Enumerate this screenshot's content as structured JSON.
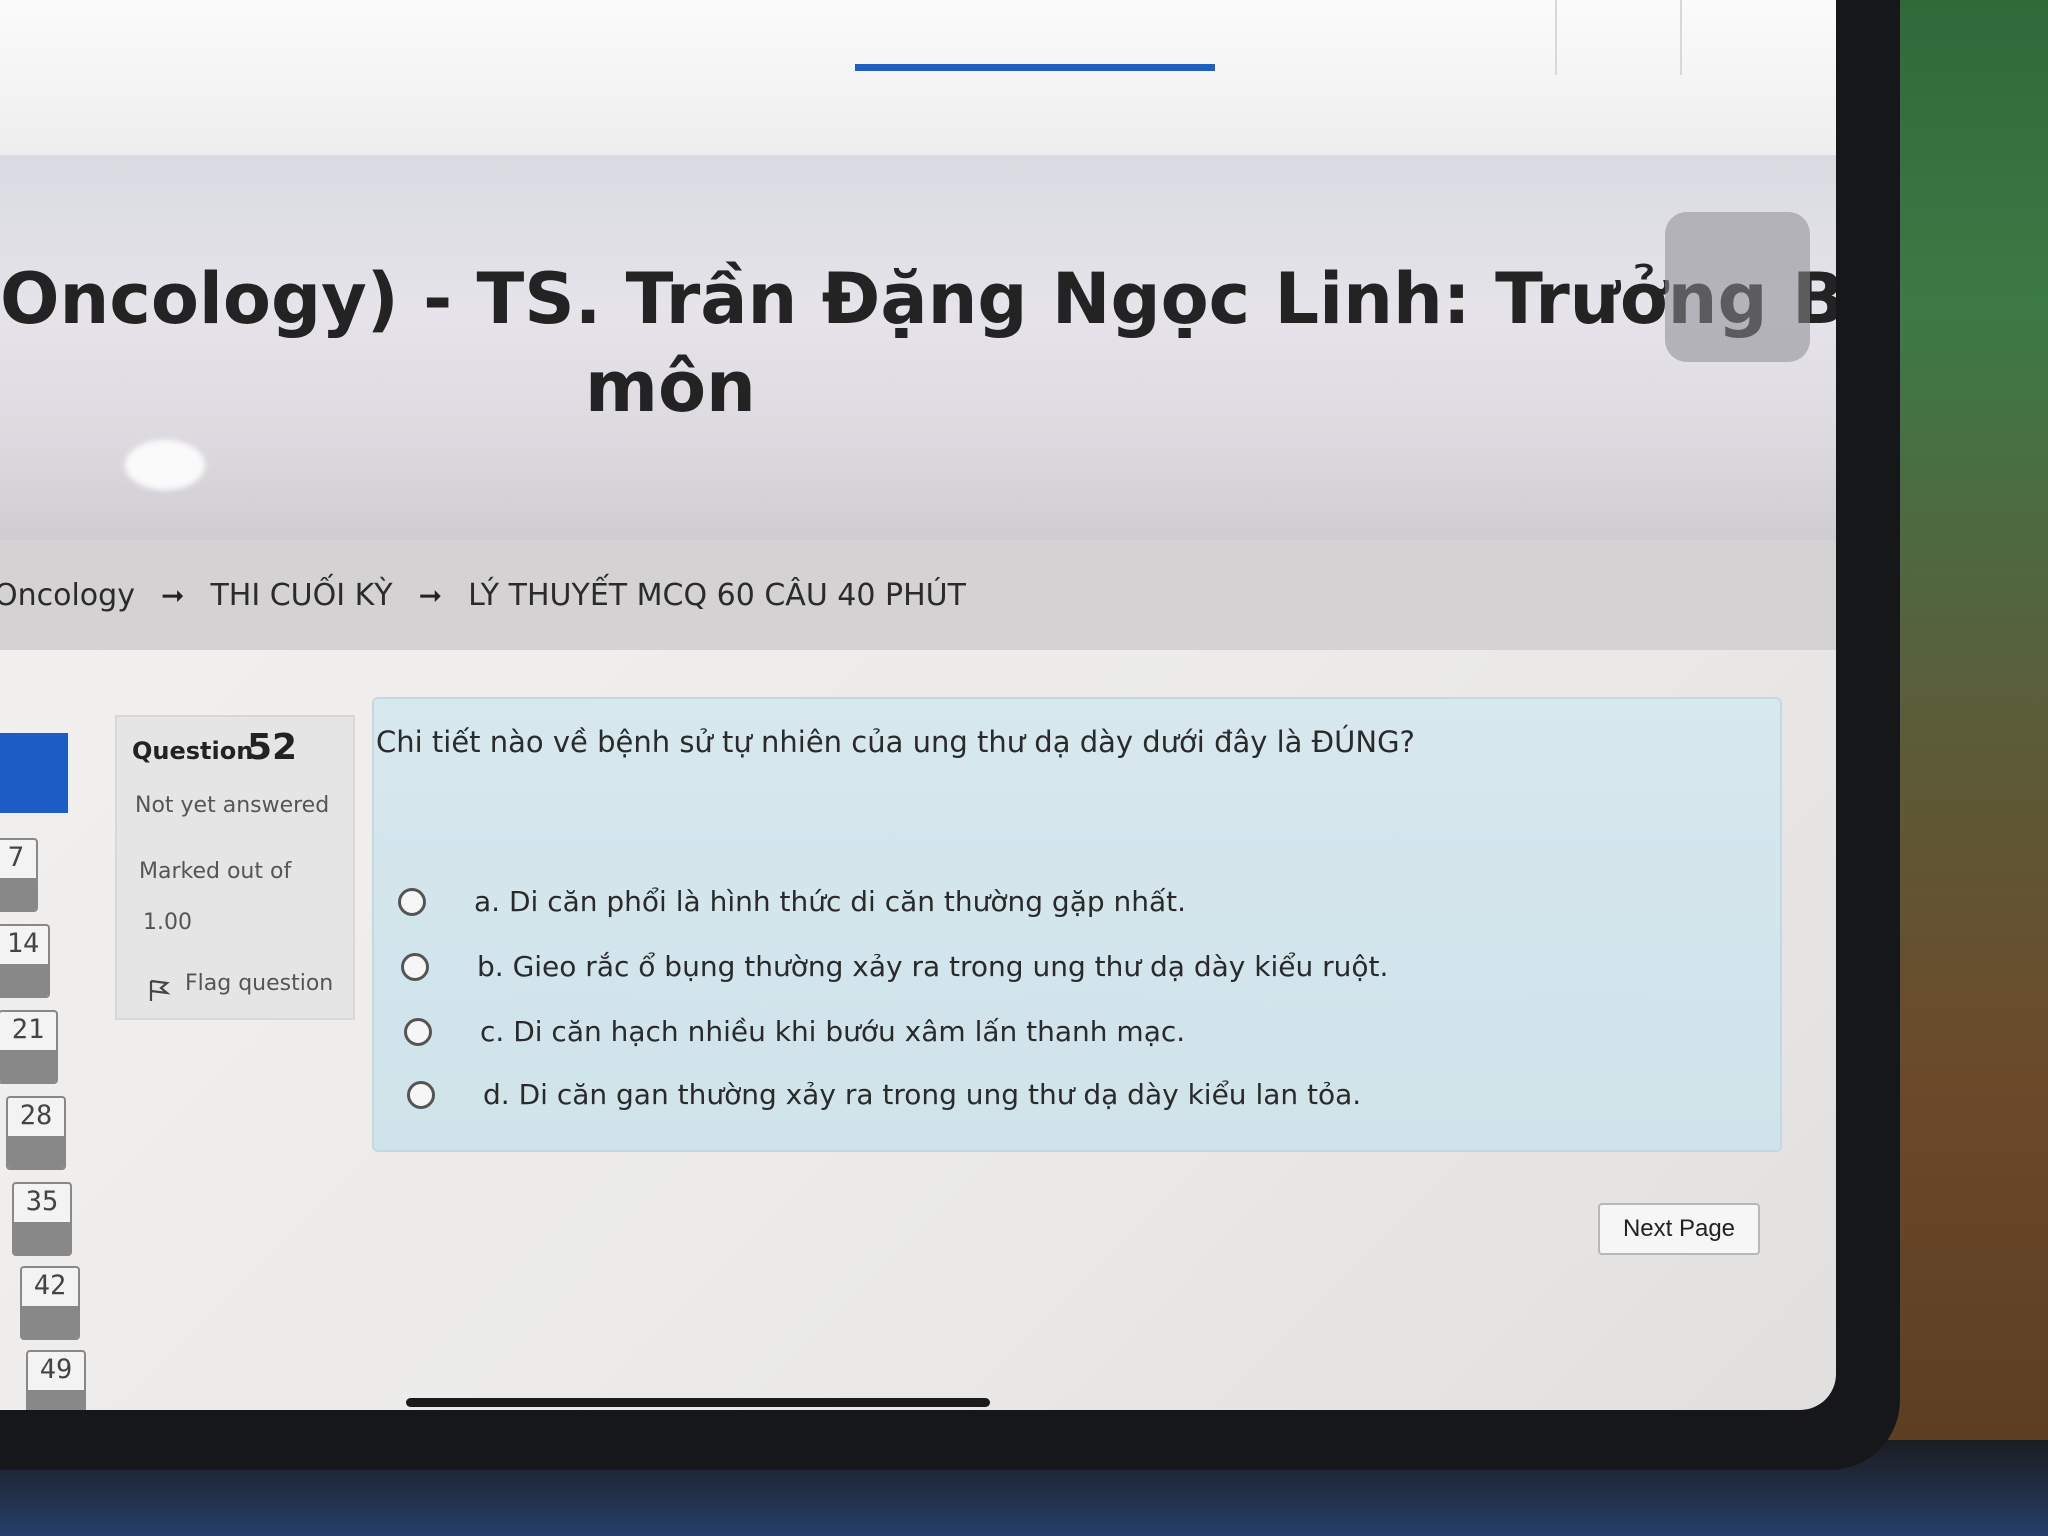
{
  "header": {
    "title_line1": "Oncology) - TS. Trần Đặng Ngọc Linh: Trưởng Bộ",
    "title_line2": "môn"
  },
  "breadcrumb": {
    "items": [
      "Oncology",
      "THI CUỐI KỲ",
      "LÝ THUYẾT MCQ 60 CÂU 40 PHÚT"
    ],
    "separator": "➞"
  },
  "quiz_nav": {
    "numbers": [
      "7",
      "14",
      "21",
      "28",
      "35",
      "42",
      "49"
    ]
  },
  "question_info": {
    "label": "Question",
    "number": "52",
    "status": "Not yet answered",
    "marked_label": "Marked out of",
    "marked_value": "1.00",
    "flag_label": "Flag question"
  },
  "question": {
    "text": "Chi tiết nào về bệnh sử tự nhiên của ung thư dạ dày dưới đây là ĐÚNG?",
    "answers": [
      "a. Di căn phổi là hình thức di căn thường gặp nhất.",
      "b. Gieo rắc ổ bụng thường xảy ra trong ung thư dạ dày kiểu ruột.",
      "c. Di căn hạch nhiều khi bướu xâm lấn thanh mạc.",
      "d. Di căn gan thường xảy ra trong ung thư dạ dày kiểu lan tỏa."
    ]
  },
  "actions": {
    "next_label": "Next Page"
  },
  "colors": {
    "accent_blue": "#1c5cc4",
    "question_panel": "#d7e8ee"
  }
}
